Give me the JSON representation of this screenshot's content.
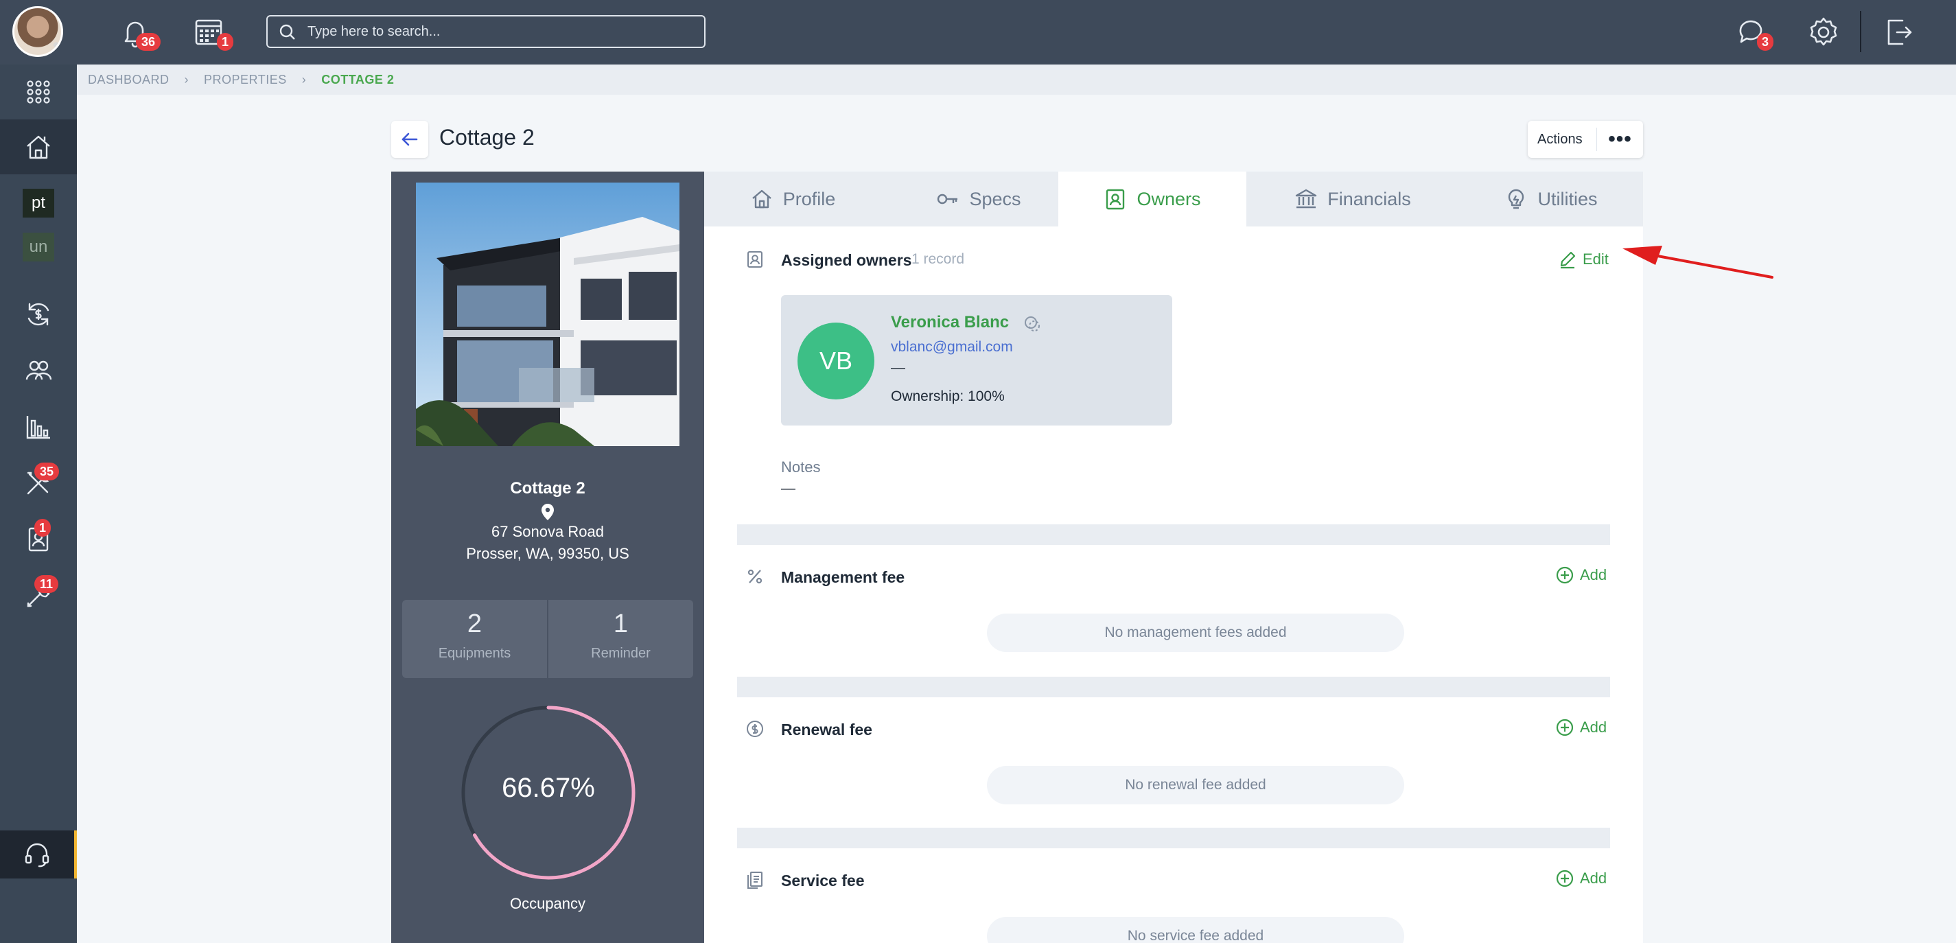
{
  "topbar": {
    "notifications_count": "36",
    "calendar_count": "1",
    "search_placeholder": "Type here to search...",
    "messages_count": "3"
  },
  "sidebar": {
    "items": [
      {
        "icon": "apps-grid-icon"
      },
      {
        "icon": "properties-house-icon",
        "active": true
      },
      {
        "label": "pt"
      },
      {
        "label": "un"
      },
      {
        "icon": "money-cycle-icon"
      },
      {
        "icon": "people-icon"
      },
      {
        "icon": "reports-chart-icon"
      },
      {
        "icon": "maintenance-tools-icon",
        "badge": "35"
      },
      {
        "icon": "contacts-icon",
        "badge": "1"
      },
      {
        "icon": "tasks-wrench-icon",
        "badge": "11"
      }
    ]
  },
  "breadcrumb": {
    "items": [
      "DASHBOARD",
      "PROPERTIES",
      "COTTAGE 2"
    ]
  },
  "page": {
    "title": "Cottage 2",
    "actions_label": "Actions",
    "actions_more": "•••"
  },
  "property": {
    "name": "Cottage 2",
    "address_line1": "67 Sonova Road",
    "address_line2": "Prosser, WA, 99350, US",
    "equipments_count": "2",
    "equipments_label": "Equipments",
    "reminder_count": "1",
    "reminder_label": "Reminder",
    "occupancy_value": "66.67%",
    "occupancy_fraction": 0.6667,
    "occupancy_label": "Occupancy"
  },
  "tabs": [
    {
      "label": "Profile",
      "icon": "house-icon"
    },
    {
      "label": "Specs",
      "icon": "key-icon"
    },
    {
      "label": "Owners",
      "icon": "owner-badge-icon",
      "active": true
    },
    {
      "label": "Financials",
      "icon": "bank-icon"
    },
    {
      "label": "Utilities",
      "icon": "lightbulb-icon"
    }
  ],
  "owners": {
    "title": "Assigned owners",
    "count": "1 record",
    "edit_label": "Edit",
    "owner": {
      "initials": "VB",
      "name": "Veronica Blanc",
      "email": "vblanc@gmail.com",
      "phone": "—",
      "ownership": "Ownership: 100%"
    },
    "notes_label": "Notes",
    "notes_value": "—"
  },
  "management_fee": {
    "title": "Management fee",
    "add_label": "Add",
    "empty": "No management fees added"
  },
  "renewal_fee": {
    "title": "Renewal fee",
    "add_label": "Add",
    "empty": "No renewal fee added"
  },
  "service_fee": {
    "title": "Service fee",
    "add_label": "Add",
    "empty": "No service fee added"
  },
  "colors": {
    "topbar": "#3e4a5a",
    "accent_green": "#3a9d4b",
    "badge_red": "#e63b3f",
    "occupancy_ring": "#f2a6c8",
    "annotation_arrow": "#e01e1e"
  }
}
